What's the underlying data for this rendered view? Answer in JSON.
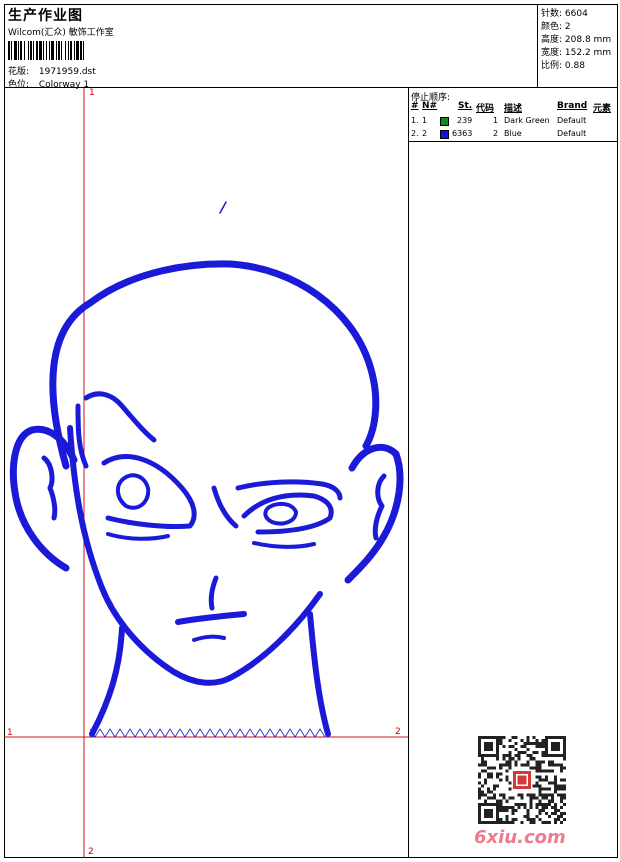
{
  "header": {
    "title": "生产作业图",
    "subtitle": "Wilcom(汇众) 敏饰工作室",
    "design_label": "花版:",
    "design_value": "1971959.dst",
    "colorway_label": "色位:",
    "colorway_value": "Colorway 1"
  },
  "stats": [
    {
      "label": "针数:",
      "value": "6604"
    },
    {
      "label": "颜色:",
      "value": "2"
    },
    {
      "label": "高度:",
      "value": "208.8 mm"
    },
    {
      "label": "宽度:",
      "value": "152.2 mm"
    },
    {
      "label": "比例:",
      "value": "0.88"
    }
  ],
  "stop_sequence": {
    "title": "停止顺序:",
    "headers": {
      "index": "#",
      "num": "N#",
      "st": "St.",
      "code": "代码",
      "desc": "描述",
      "brand": "Brand",
      "element": "元素"
    },
    "rows": [
      {
        "index": "1.",
        "num": "1",
        "color": "#138a13",
        "st": "239",
        "code": "1",
        "desc": "Dark Green",
        "brand": "Default"
      },
      {
        "index": "2.",
        "num": "2",
        "color": "#1010e0",
        "st": "6363",
        "code": "2",
        "desc": "Blue",
        "brand": "Default"
      }
    ]
  },
  "axis_labels": {
    "top": "1",
    "left": "1",
    "right": "2",
    "bottom": "2"
  },
  "stitch_color": "#1a1ad8",
  "axis_color": "#d01010",
  "watermark": "6xiu.com"
}
